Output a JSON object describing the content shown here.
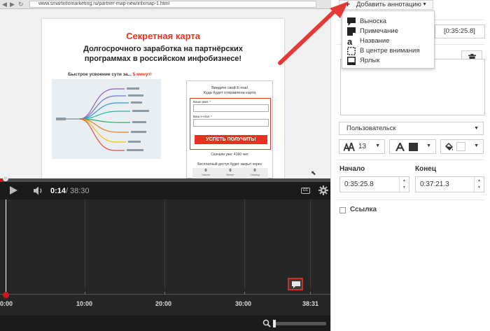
{
  "browser": {
    "url": "www.smartinfomarketing.ru/partner-map-new/inlxmap-1.html"
  },
  "landing": {
    "title": "Секретная карта",
    "subtitle": "Долгосрочного заработка на партнёрских\nпрограммах в российском инфобизнесе!",
    "mindmap_caption_prefix": "Быстрое усвоение сути за...",
    "mindmap_caption_highlight": "5 минут!",
    "form_title": "Введите свой E-mail\nКуда будет отправлена карта",
    "name_label": "Ваше имя: *",
    "email_label": "Ваш e-mail: *",
    "submit_label": "УСПЕТЬ ПОЛУЧИТЬ!",
    "views_text": "Скачали уже: 4160 чел",
    "access_text": "Бесплатный доступ будет закрыт через",
    "countdown": [
      {
        "value": "0",
        "label": "Часов"
      },
      {
        "value": "0",
        "label": "Минут"
      },
      {
        "value": "0",
        "label": "Секунд"
      }
    ]
  },
  "player": {
    "current_time": "0:14",
    "separator": "/",
    "total_time": "38:30",
    "progress_fraction": 0.006
  },
  "timeline": {
    "ticks": [
      "0:00",
      "10:00",
      "20:00",
      "30:00",
      "38:31"
    ]
  },
  "panel": {
    "add_annotation_label": "Добавить аннотацию",
    "menu_items": [
      {
        "label": "Выноска",
        "icon": "speech-bubble-icon"
      },
      {
        "label": "Примечание",
        "icon": "note-icon"
      },
      {
        "label": "Название",
        "icon": "title-a-icon"
      },
      {
        "label": "В центре внимания",
        "icon": "spotlight-icon"
      },
      {
        "label": "Ярлык",
        "icon": "label-icon"
      }
    ],
    "time_dropdown": "[0:35:25.8]",
    "annotation_text": "",
    "style_select": "Пользовательск",
    "font_size": "13",
    "text_color": "#333333",
    "bg_color": "#ffffff",
    "start_label": "Начало",
    "end_label": "Конец",
    "start_value": "0:35:25.8",
    "end_value": "0:37:21.3",
    "link_label": "Ссылка"
  }
}
